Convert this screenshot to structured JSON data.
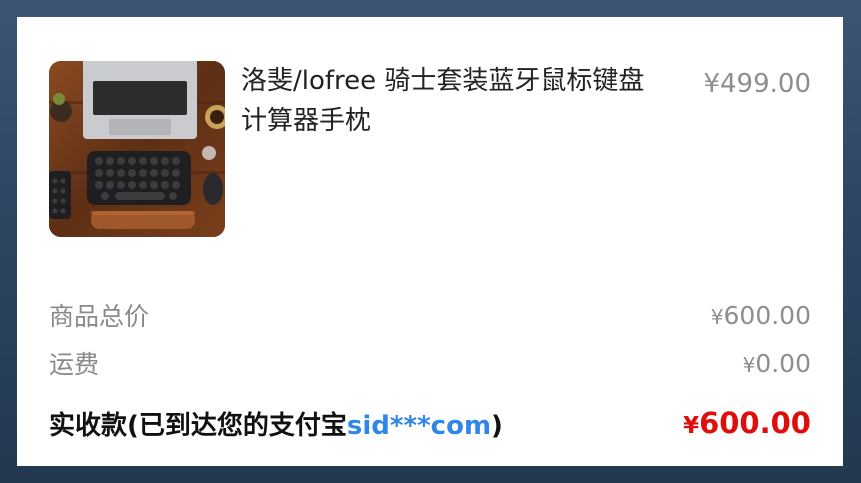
{
  "product": {
    "image_icon": "keyboard-mouse-laptop-photo",
    "title": "洛斐/lofree 骑士套装蓝牙鼠标键盘计算器手枕",
    "price": "¥499.00"
  },
  "summary": {
    "goods_total_label": "商品总价",
    "goods_total_currency": "¥",
    "goods_total_value": "600.00",
    "shipping_label": "运费",
    "shipping_currency": "¥",
    "shipping_value": "0.00",
    "received_label_prefix": "实收款(已到达您的支付宝",
    "received_account": "sid***com",
    "received_label_suffix": ")",
    "received_currency": "¥",
    "received_value": "600.00"
  },
  "colors": {
    "page_background": "#2d4764",
    "accent_blue": "#2f86e8",
    "price_red": "#e00d0d"
  }
}
